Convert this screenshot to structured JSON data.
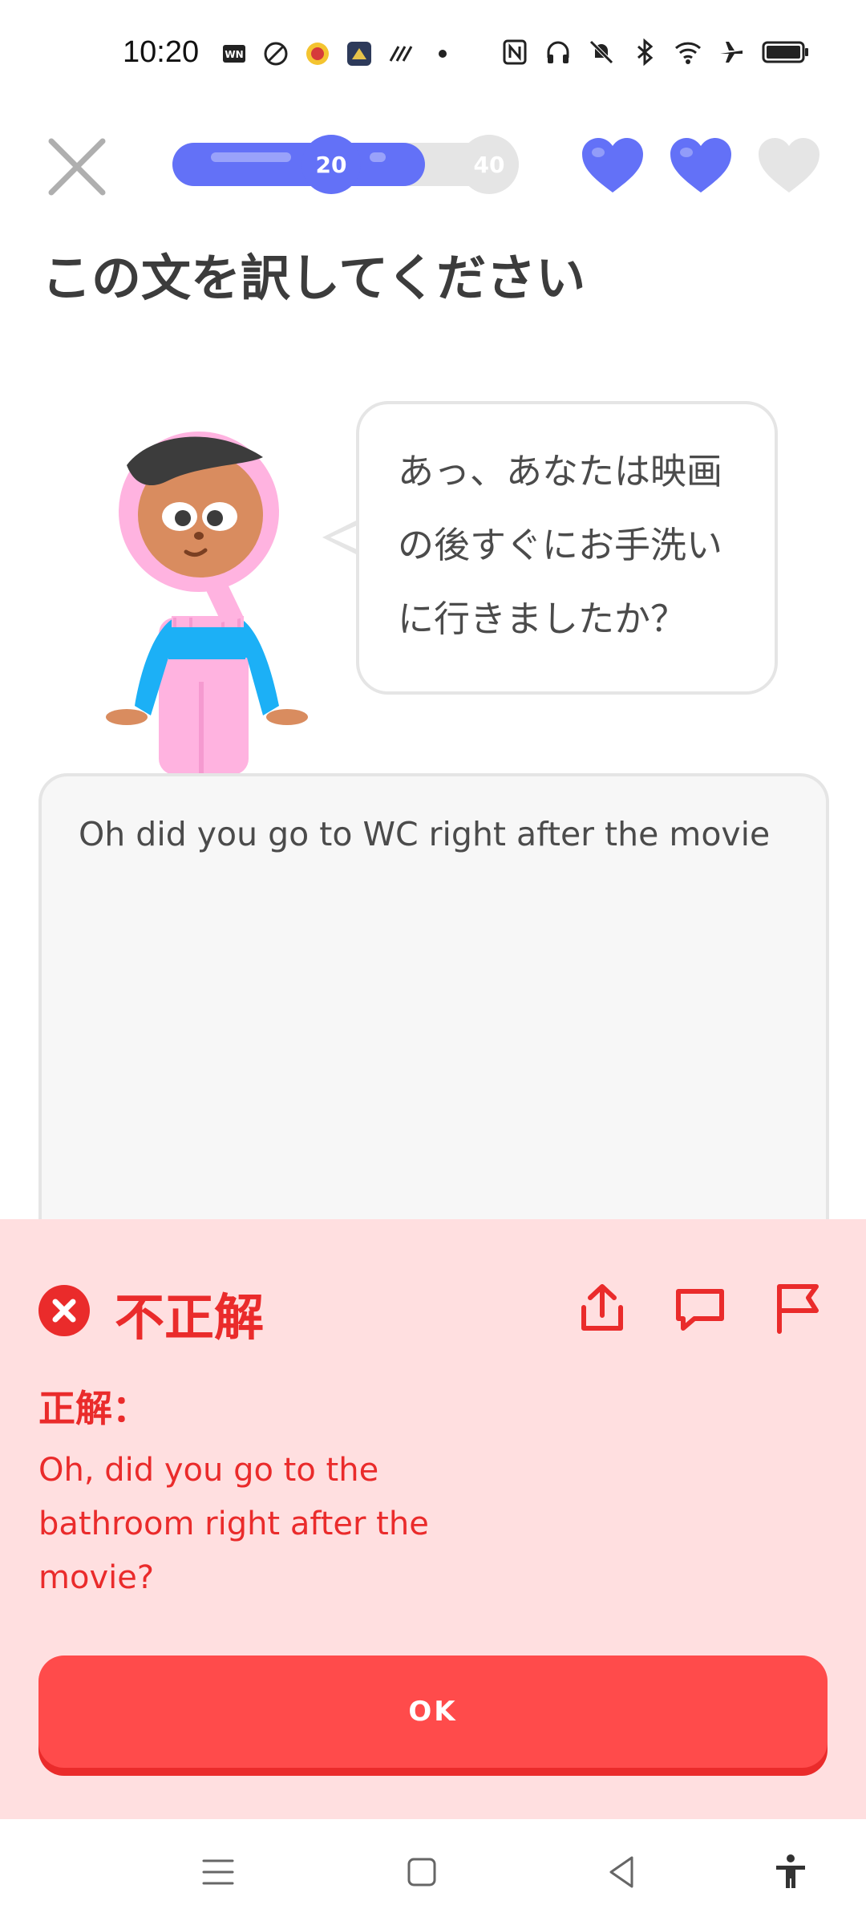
{
  "status_bar": {
    "time": "10:20",
    "left_icons": [
      "app-notification-icon",
      "app-notification-icon",
      "app-notification-icon",
      "app-notification-icon",
      "app-notification-icon",
      "dot-icon"
    ],
    "right_icons": [
      "nfc-icon",
      "headphones-icon",
      "mute-icon",
      "bluetooth-icon",
      "wifi-icon",
      "airplane-icon",
      "battery-icon"
    ]
  },
  "header": {
    "progress_fraction": 0.73,
    "milestones": [
      "20",
      "40"
    ],
    "hearts": {
      "total": 3,
      "filled": 2
    }
  },
  "prompt": {
    "title": "この文を訳してください",
    "sentence_lines": [
      "あっ、あなたは映画",
      "の後すぐにお手洗い",
      "に行きましたか？"
    ]
  },
  "answer": {
    "text": "Oh did you go to WC right after the movie"
  },
  "feedback": {
    "title": "不正解",
    "label": "正解：",
    "correct_lines": [
      "Oh, did you go to the",
      "bathroom right after the",
      "movie?"
    ],
    "ok_label": "OK",
    "actions": [
      "share-icon",
      "comment-icon",
      "report-flag-icon"
    ]
  },
  "navbar": {
    "buttons": [
      "menu-icon",
      "home-square-icon",
      "back-triangle-icon",
      "accessibility-icon"
    ]
  },
  "colors": {
    "accent": "#6371f7",
    "error": "#ea2b2b",
    "error_bg": "#ffdfe0",
    "button": "#ff4b4b"
  }
}
